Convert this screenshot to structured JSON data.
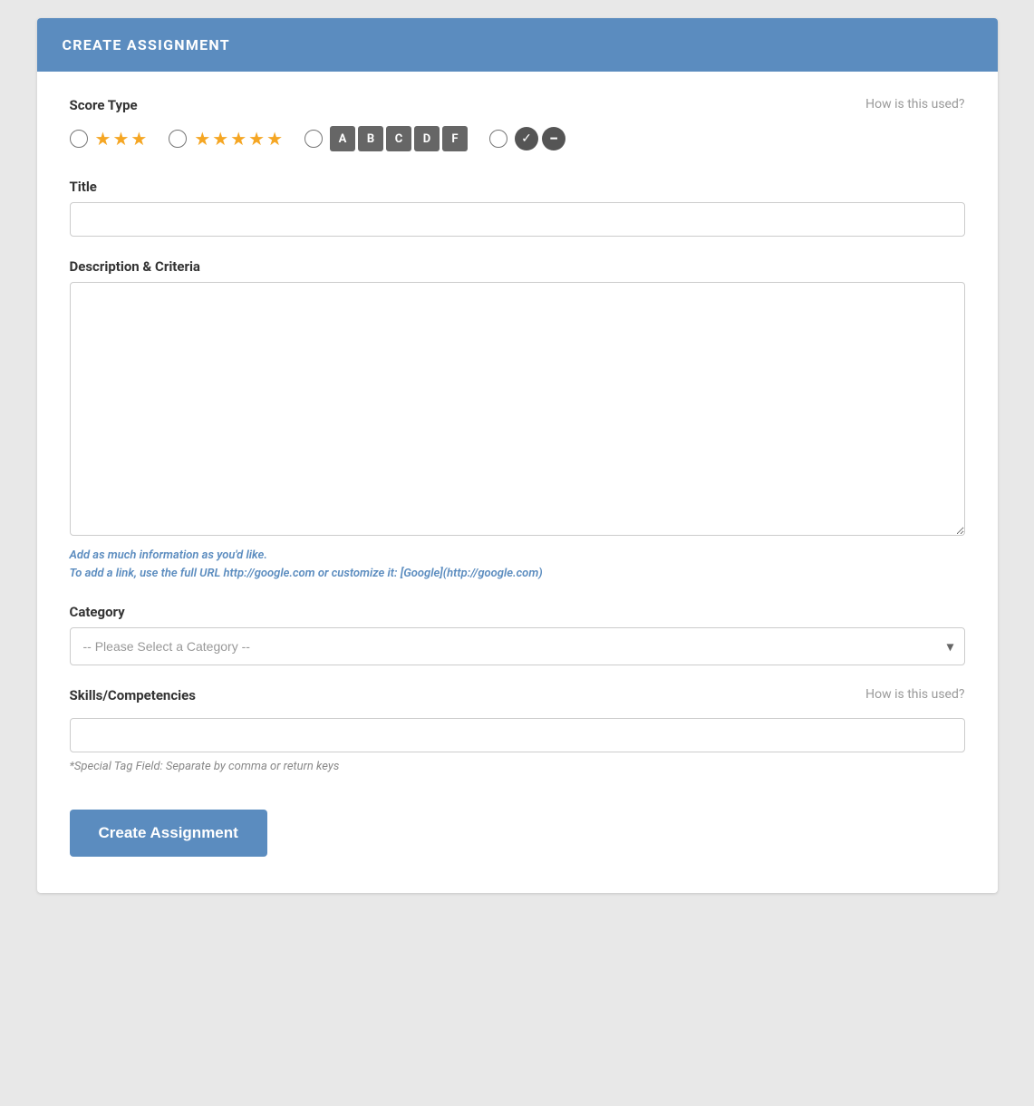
{
  "header": {
    "title": "CREATE ASSIGNMENT"
  },
  "score_type": {
    "label": "Score Type",
    "how_used_link": "How is this used?",
    "options": [
      {
        "id": "score-3star",
        "type": "3star",
        "stars": 3
      },
      {
        "id": "score-5star",
        "type": "5star",
        "stars": 5
      },
      {
        "id": "score-letter",
        "type": "letter",
        "grades": [
          "A",
          "B",
          "C",
          "D",
          "F"
        ]
      },
      {
        "id": "score-passfail",
        "type": "passfail"
      }
    ]
  },
  "title_field": {
    "label": "Title",
    "placeholder": "",
    "value": ""
  },
  "description_field": {
    "label": "Description & Criteria",
    "placeholder": "",
    "value": "",
    "help_line1": "Add as much information as you'd like.",
    "help_line2_prefix": "To add a link, use the full URL ",
    "help_link1": "http://google.com",
    "help_line2_mid": " or customize it: ",
    "help_link2": "[Google](http://google.com)"
  },
  "category_field": {
    "label": "Category",
    "placeholder": "-- Please Select a Category --",
    "options": []
  },
  "skills_field": {
    "label": "Skills/Competencies",
    "how_used_link": "How is this used?",
    "placeholder": "",
    "value": "",
    "special_tag_help": "*Special Tag Field: Separate by comma or return keys"
  },
  "submit_button": {
    "label": "Create Assignment"
  }
}
